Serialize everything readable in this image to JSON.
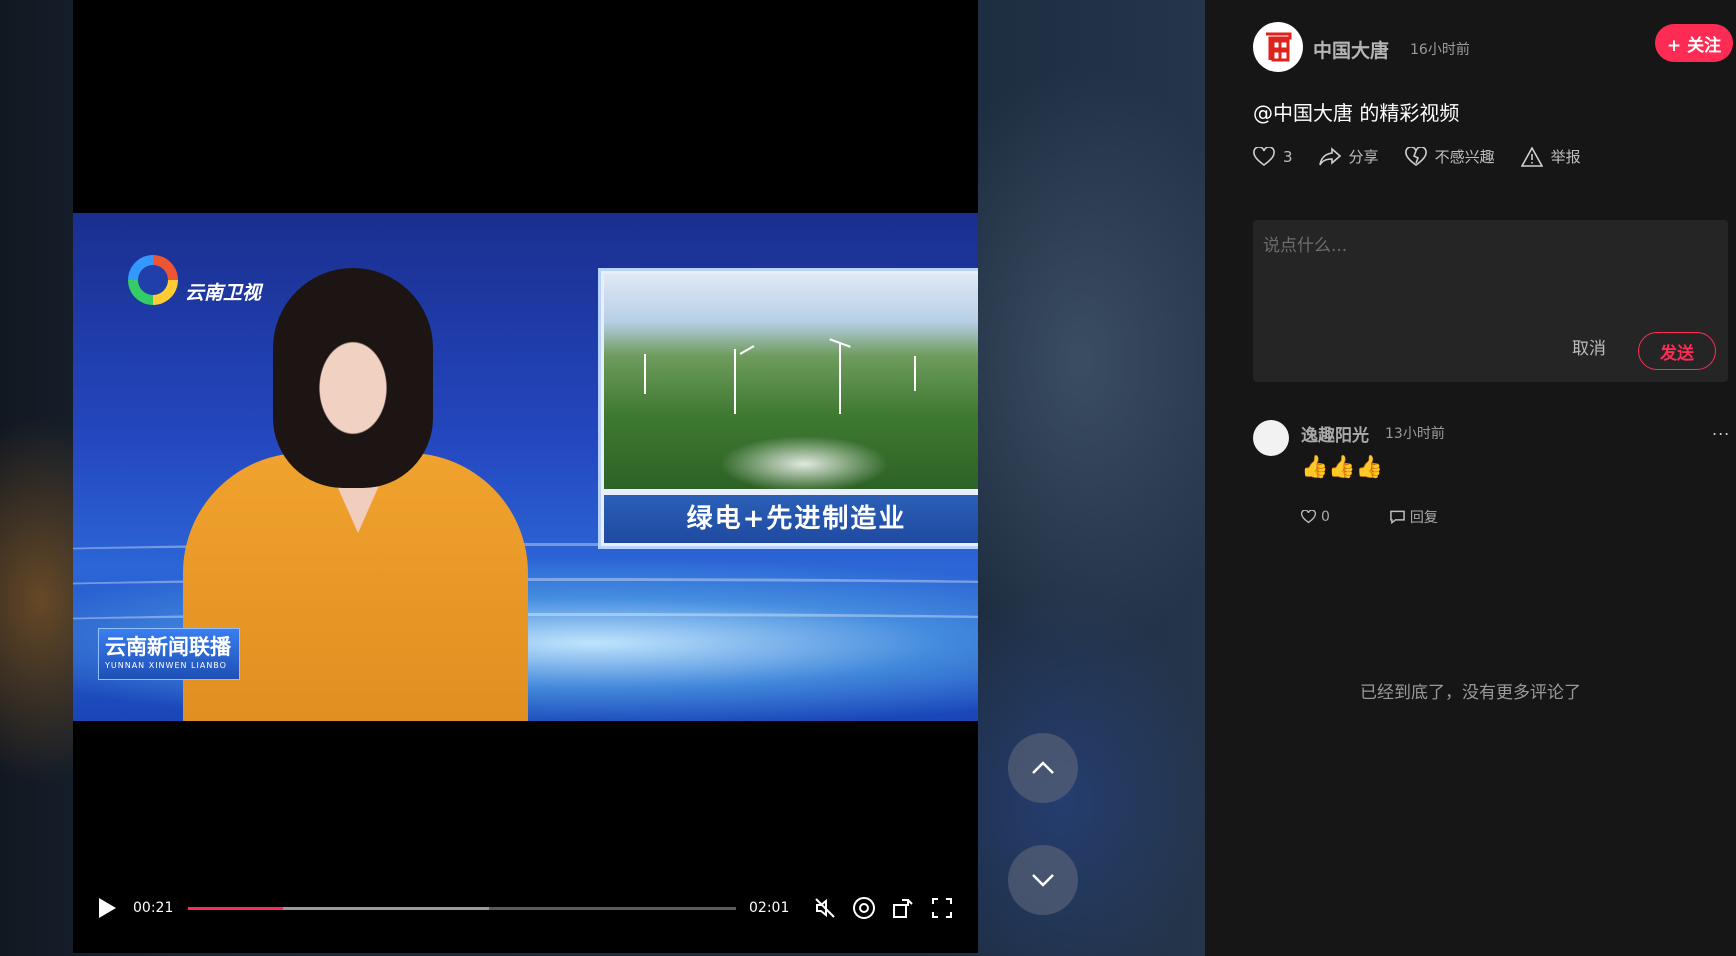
{
  "video": {
    "channel_name": "云南卫视",
    "inset_caption": "绿电+先进制造业",
    "news_badge_title": "云南新闻联播",
    "news_badge_sub": "YUNNAN XINWEN LIANBO",
    "current_time": "00:21",
    "duration": "02:01",
    "progress_fraction": 0.174,
    "buffered_fraction": 0.55
  },
  "navigation": {
    "up_icon": "chevron-up-icon",
    "down_icon": "chevron-down-icon"
  },
  "post": {
    "author": "中国大唐",
    "posted_ago": "16小时前",
    "follow_label": "+ 关注",
    "caption": "@中国大唐 的精彩视频",
    "actions": {
      "like_count": "3",
      "share_label": "分享",
      "not_interested_label": "不感兴趣",
      "report_label": "举报"
    }
  },
  "compose": {
    "placeholder": "说点什么...",
    "cancel_label": "取消",
    "send_label": "发送"
  },
  "comments": [
    {
      "user": "逸趣阳光",
      "time": "13小时前",
      "text": "👍👍👍",
      "likes": "0",
      "reply_label": "回复",
      "more": "..."
    }
  ],
  "end_note": "已经到底了，没有更多评论了",
  "colors": {
    "accent": "#fe2c55",
    "panel_bg": "#161616",
    "input_bg": "#252525"
  }
}
